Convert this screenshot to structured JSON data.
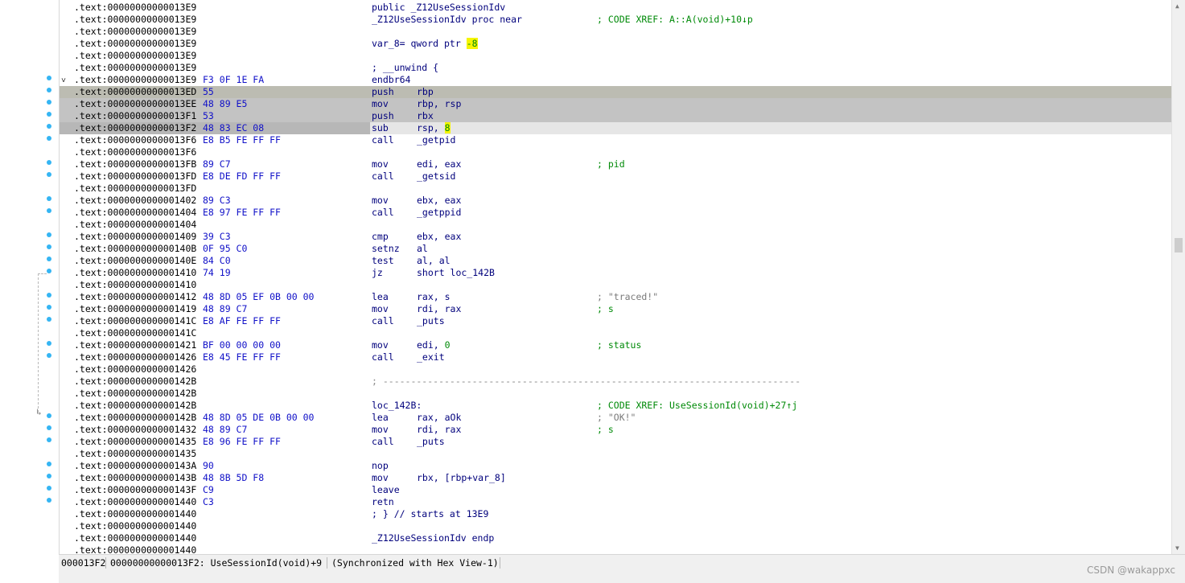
{
  "listing": {
    "rows": [
      {
        "addr": ".text:00000000000013E9",
        "bytes": "",
        "text": "public _Z12UseSessionIdv",
        "kind": "plain"
      },
      {
        "addr": ".text:00000000000013E9",
        "bytes": "",
        "text": "_Z12UseSessionIdv proc near",
        "comment": "; CODE XREF: A::A(void)+10↓p",
        "kind": "plain"
      },
      {
        "addr": ".text:00000000000013E9",
        "bytes": "",
        "text": "",
        "kind": "plain"
      },
      {
        "addr": ".text:00000000000013E9",
        "bytes": "",
        "text": "var_8= qword ptr ",
        "suffix_hl": "-8",
        "kind": "var"
      },
      {
        "addr": ".text:00000000000013E9",
        "bytes": "",
        "text": "",
        "kind": "plain"
      },
      {
        "addr": ".text:00000000000013E9",
        "bytes": "",
        "text": "; __unwind {",
        "kind": "plain"
      },
      {
        "addr": ".text:00000000000013E9",
        "bytes": "F3 0F 1E FA",
        "mnemonic": "endbr64",
        "operands": "",
        "kind": "ins"
      },
      {
        "addr": ".text:00000000000013ED",
        "bytes": "55",
        "mnemonic": "push",
        "operands": "rbp",
        "kind": "ins"
      },
      {
        "addr": ".text:00000000000013EE",
        "bytes": "48 89 E5",
        "mnemonic": "mov",
        "operands": "rbp, rsp",
        "kind": "ins"
      },
      {
        "addr": ".text:00000000000013F1",
        "bytes": "53",
        "mnemonic": "push",
        "operands": "rbx",
        "kind": "ins"
      },
      {
        "addr": ".text:00000000000013F2",
        "bytes": "48 83 EC 08",
        "mnemonic": "sub",
        "operands": "rsp, ",
        "operand_hl": "8",
        "kind": "ins"
      },
      {
        "addr": ".text:00000000000013F6",
        "bytes": "E8 B5 FE FF FF",
        "mnemonic": "call",
        "operands": "_getpid",
        "kind": "ins"
      },
      {
        "addr": ".text:00000000000013F6",
        "bytes": "",
        "kind": "blank"
      },
      {
        "addr": ".text:00000000000013FB",
        "bytes": "89 C7",
        "mnemonic": "mov",
        "operands": "edi, eax",
        "comment": "; pid",
        "kind": "ins"
      },
      {
        "addr": ".text:00000000000013FD",
        "bytes": "E8 DE FD FF FF",
        "mnemonic": "call",
        "operands": "_getsid",
        "kind": "ins"
      },
      {
        "addr": ".text:00000000000013FD",
        "bytes": "",
        "kind": "blank"
      },
      {
        "addr": ".text:0000000000001402",
        "bytes": "89 C3",
        "mnemonic": "mov",
        "operands": "ebx, eax",
        "kind": "ins"
      },
      {
        "addr": ".text:0000000000001404",
        "bytes": "E8 97 FE FF FF",
        "mnemonic": "call",
        "operands": "_getppid",
        "kind": "ins"
      },
      {
        "addr": ".text:0000000000001404",
        "bytes": "",
        "kind": "blank"
      },
      {
        "addr": ".text:0000000000001409",
        "bytes": "39 C3",
        "mnemonic": "cmp",
        "operands": "ebx, eax",
        "kind": "ins"
      },
      {
        "addr": ".text:000000000000140B",
        "bytes": "0F 95 C0",
        "mnemonic": "setnz",
        "operands": "al",
        "kind": "ins"
      },
      {
        "addr": ".text:000000000000140E",
        "bytes": "84 C0",
        "mnemonic": "test",
        "operands": "al, al",
        "kind": "ins"
      },
      {
        "addr": ".text:0000000000001410",
        "bytes": "74 19",
        "mnemonic": "jz",
        "operands": "short loc_142B",
        "kind": "ins"
      },
      {
        "addr": ".text:0000000000001410",
        "bytes": "",
        "kind": "blank"
      },
      {
        "addr": ".text:0000000000001412",
        "bytes": "48 8D 05 EF 0B 00 00",
        "mnemonic": "lea",
        "operands": "rax, s",
        "comment": "; \"traced!\"",
        "comment_kind": "str",
        "kind": "ins"
      },
      {
        "addr": ".text:0000000000001419",
        "bytes": "48 89 C7",
        "mnemonic": "mov",
        "operands": "rdi, rax",
        "comment": "; s",
        "kind": "ins"
      },
      {
        "addr": ".text:000000000000141C",
        "bytes": "E8 AF FE FF FF",
        "mnemonic": "call",
        "operands": "_puts",
        "kind": "ins"
      },
      {
        "addr": ".text:000000000000141C",
        "bytes": "",
        "kind": "blank"
      },
      {
        "addr": ".text:0000000000001421",
        "bytes": "BF 00 00 00 00",
        "mnemonic": "mov",
        "operands": "edi, ",
        "operand_num": "0",
        "comment": "; status",
        "kind": "ins"
      },
      {
        "addr": ".text:0000000000001426",
        "bytes": "E8 45 FE FF FF",
        "mnemonic": "call",
        "operands": "_exit",
        "kind": "ins"
      },
      {
        "addr": ".text:0000000000001426",
        "bytes": "",
        "kind": "blank"
      },
      {
        "addr": ".text:000000000000142B",
        "bytes": "",
        "text": "; ---------------------------------------------------------------------------",
        "kind": "sep"
      },
      {
        "addr": ".text:000000000000142B",
        "bytes": "",
        "kind": "blank"
      },
      {
        "addr": ".text:000000000000142B",
        "bytes": "",
        "text": "loc_142B:",
        "comment": "; CODE XREF: UseSessionId(void)+27↑j",
        "kind": "plain"
      },
      {
        "addr": ".text:000000000000142B",
        "bytes": "48 8D 05 DE 0B 00 00",
        "mnemonic": "lea",
        "operands": "rax, aOk",
        "comment": "; \"OK!\"",
        "comment_kind": "str",
        "kind": "ins"
      },
      {
        "addr": ".text:0000000000001432",
        "bytes": "48 89 C7",
        "mnemonic": "mov",
        "operands": "rdi, rax",
        "comment": "; s",
        "kind": "ins"
      },
      {
        "addr": ".text:0000000000001435",
        "bytes": "E8 96 FE FF FF",
        "mnemonic": "call",
        "operands": "_puts",
        "kind": "ins"
      },
      {
        "addr": ".text:0000000000001435",
        "bytes": "",
        "kind": "blank"
      },
      {
        "addr": ".text:000000000000143A",
        "bytes": "90",
        "mnemonic": "nop",
        "operands": "",
        "kind": "ins"
      },
      {
        "addr": ".text:000000000000143B",
        "bytes": "48 8B 5D F8",
        "mnemonic": "mov",
        "operands": "rbx, [rbp+var_8]",
        "kind": "ins"
      },
      {
        "addr": ".text:000000000000143F",
        "bytes": "C9",
        "mnemonic": "leave",
        "operands": "",
        "kind": "ins"
      },
      {
        "addr": ".text:0000000000001440",
        "bytes": "C3",
        "mnemonic": "retn",
        "operands": "",
        "kind": "ins"
      },
      {
        "addr": ".text:0000000000001440",
        "bytes": "",
        "text": "; } // starts at 13E9",
        "kind": "plain"
      },
      {
        "addr": ".text:0000000000001440",
        "bytes": "",
        "kind": "blank"
      },
      {
        "addr": ".text:0000000000001440",
        "bytes": "",
        "text": "_Z12UseSessionIdv endp",
        "kind": "plain"
      },
      {
        "addr": ".text:0000000000001440",
        "bytes": "",
        "kind": "blank"
      }
    ],
    "highlight_rows": {
      "7": "hl1",
      "8": "hl2",
      "9": "hl2",
      "10": "hl3"
    },
    "dot_rows": [
      6,
      7,
      8,
      9,
      10,
      11,
      13,
      14,
      16,
      17,
      19,
      20,
      21,
      22,
      24,
      25,
      26,
      28,
      29,
      34,
      35,
      36,
      38,
      39,
      40,
      41
    ]
  },
  "status": {
    "offset": "000013F2",
    "location": "00000000000013F2: UseSessionId(void)+9",
    "sync": "(Synchronized with Hex View-1)"
  },
  "watermark": "CSDN @wakappxc",
  "colors": {
    "address": "#000000",
    "bytes": "#1010c8",
    "instruction": "#00007c",
    "comment": "#008a08",
    "string_comment": "#7a7a7a",
    "highlight": "#f5f500",
    "gutter_dot": "#35b5f3"
  }
}
